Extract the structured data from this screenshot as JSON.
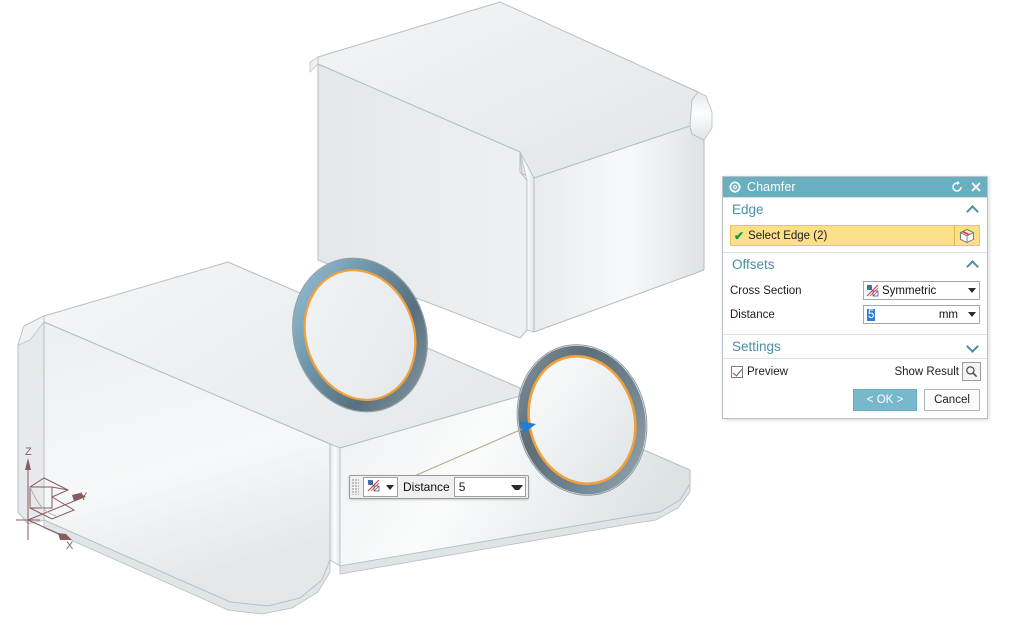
{
  "viewport": {
    "triad": {
      "z_label": "Z",
      "y_label": "Y",
      "x_label": "X",
      "color": "#8a5a5e"
    },
    "model": {
      "description": "stepped L-shaped block with rounded edges and two chamfered circular holes",
      "body_color": "#e9ecee",
      "edge_color": "#9aa3a8",
      "chamfer_highlight_color": "#f0a13c",
      "chamfer_band_color": "#6b8fa6"
    },
    "handle": {
      "name": "distance-drag-arrow",
      "color": "#1f7fd4",
      "leader_color": "#b5a98a"
    }
  },
  "hud": {
    "drag_handle": "drag-grip",
    "cross_section_icon": "chamfer-symmetric-icon",
    "label": "Distance",
    "value": "5"
  },
  "dialog": {
    "title": "Chamfer",
    "title_icon": "gear-icon",
    "reset_icon": "reset-icon",
    "close_icon": "close-icon",
    "sections": {
      "edge": {
        "title": "Edge",
        "expanded": true,
        "select_edge_label": "Select Edge (2)",
        "select_edge_check": "✔",
        "pick_icon": "cube-edge-select-icon",
        "highlight_color": "#fcdf8a"
      },
      "offsets": {
        "title": "Offsets",
        "expanded": true,
        "cross_section_label": "Cross Section",
        "cross_section_value": "Symmetric",
        "cross_section_icon": "chamfer-symmetric-icon",
        "distance_label": "Distance",
        "distance_value": "5",
        "distance_unit": "mm"
      },
      "settings": {
        "title": "Settings",
        "expanded": false,
        "preview_label": "Preview",
        "preview_checked": true,
        "show_result_label": "Show Result",
        "show_result_icon": "magnifier-icon"
      }
    },
    "buttons": {
      "ok_label": "< OK >",
      "cancel_label": "Cancel",
      "ok_color": "#77b8cb"
    }
  }
}
